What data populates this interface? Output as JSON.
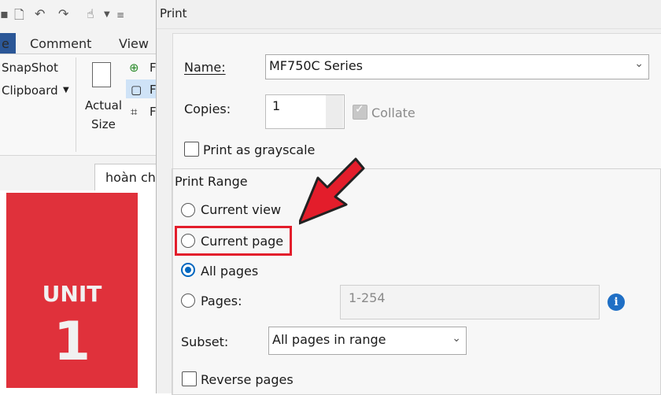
{
  "app": {
    "tabs": [
      "e",
      "Comment",
      "View"
    ],
    "ribbon": {
      "snapshot": "SnapShot",
      "clipboard": "Clipboard",
      "actual_size_1": "Actual",
      "actual_size_2": "Size",
      "fit_label": "F"
    },
    "doc_tab": "hoàn ch",
    "document": {
      "unit_label": "UNIT",
      "unit_number": "1"
    }
  },
  "dialog": {
    "title": "Print",
    "name_label": "Name:",
    "printer": "MF750C Series",
    "copies_label": "Copies:",
    "copies_value": "1",
    "collate_label": "Collate",
    "grayscale_label": "Print as grayscale",
    "range_title": "Print Range",
    "current_view": "Current view",
    "current_page": "Current page",
    "all_pages": "All pages",
    "pages_label": "Pages:",
    "pages_placeholder": "1-254",
    "subset_label": "Subset:",
    "subset_value": "All pages in range",
    "reverse_label": "Reverse pages"
  },
  "colors": {
    "accent": "#0067c0",
    "annotation": "#e31d2b",
    "unit_block": "#e0313b"
  }
}
